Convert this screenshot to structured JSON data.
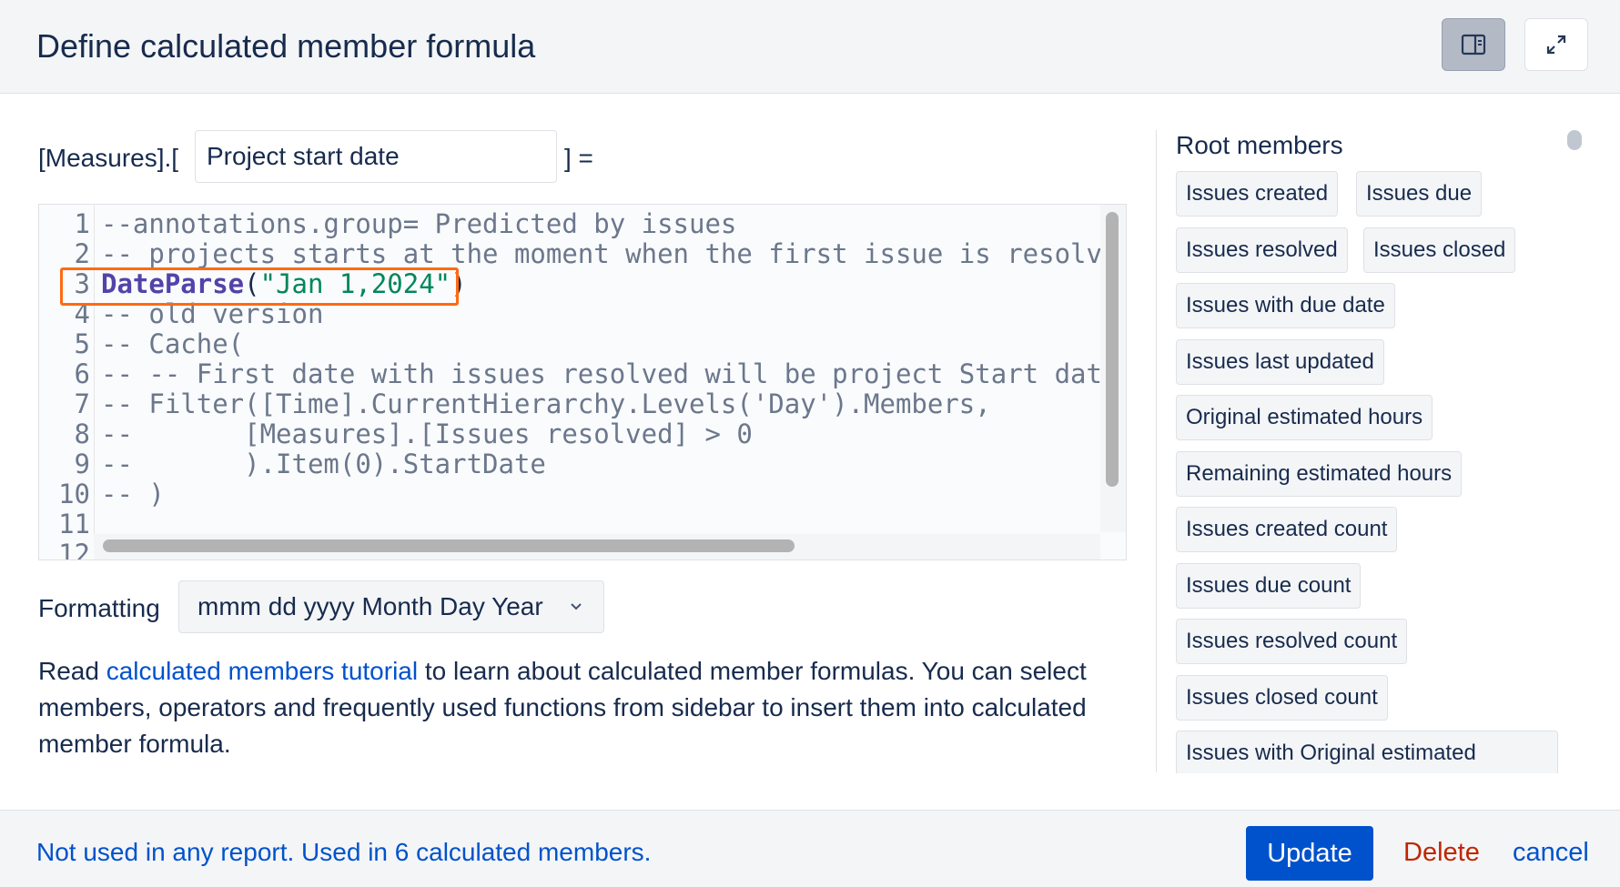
{
  "dialog": {
    "title": "Define calculated member formula",
    "sidebar_toggle_icon": "sidebar-panel-icon",
    "expand_icon": "expand-arrows-icon"
  },
  "measure": {
    "prefix": "[Measures].[",
    "name_value": "Project start date",
    "suffix": "] ="
  },
  "editor": {
    "line_numbers": [
      "1",
      "2",
      "3",
      "4",
      "5",
      "6",
      "7",
      "8",
      "9",
      "10",
      "11",
      "12"
    ],
    "lines": [
      "--annotations.group= Predicted by issues",
      "-- projects starts at the moment when the first issue is resolved",
      "",
      "-- old version",
      "-- Cache(",
      "-- -- First date with issues resolved will be project Start date",
      "-- Filter([Time].CurrentHierarchy.Levels('Day').Members,",
      "--       [Measures].[Issues resolved] > 0",
      "--       ).Item(0).StartDate",
      "-- )",
      "",
      ""
    ],
    "line3": {
      "func": "DateParse",
      "open": "(",
      "arg": "\"Jan 1,2024\"",
      "close": ")"
    },
    "highlight_color": "#ff6a13"
  },
  "formatting": {
    "label": "Formatting",
    "selected": "mmm dd yyyy Month Day Year",
    "chevron_icon": "chevron-down-icon"
  },
  "help": {
    "prefix": "Read ",
    "link": "calculated members tutorial",
    "suffix": " to learn about calculated member formulas. You can select members, operators and frequently used functions from sidebar to insert them into calculated member formula."
  },
  "sidebar": {
    "title": "Root members",
    "items": [
      "Issues created",
      "Issues due",
      "Issues resolved",
      "Issues closed",
      "Issues with due date",
      "Issues last updated",
      "Original estimated hours",
      "Remaining estimated hours",
      "Issues created count",
      "Issues due count",
      "Issues resolved count",
      "Issues closed count",
      "Issues with Original estimated"
    ]
  },
  "footer": {
    "usage": "Not used in any report. Used in 6 calculated members.",
    "update": "Update",
    "delete": "Delete",
    "cancel": "cancel"
  },
  "colors": {
    "primary": "#0052cc",
    "danger": "#bf2600",
    "header_bg": "#f4f5f7"
  }
}
